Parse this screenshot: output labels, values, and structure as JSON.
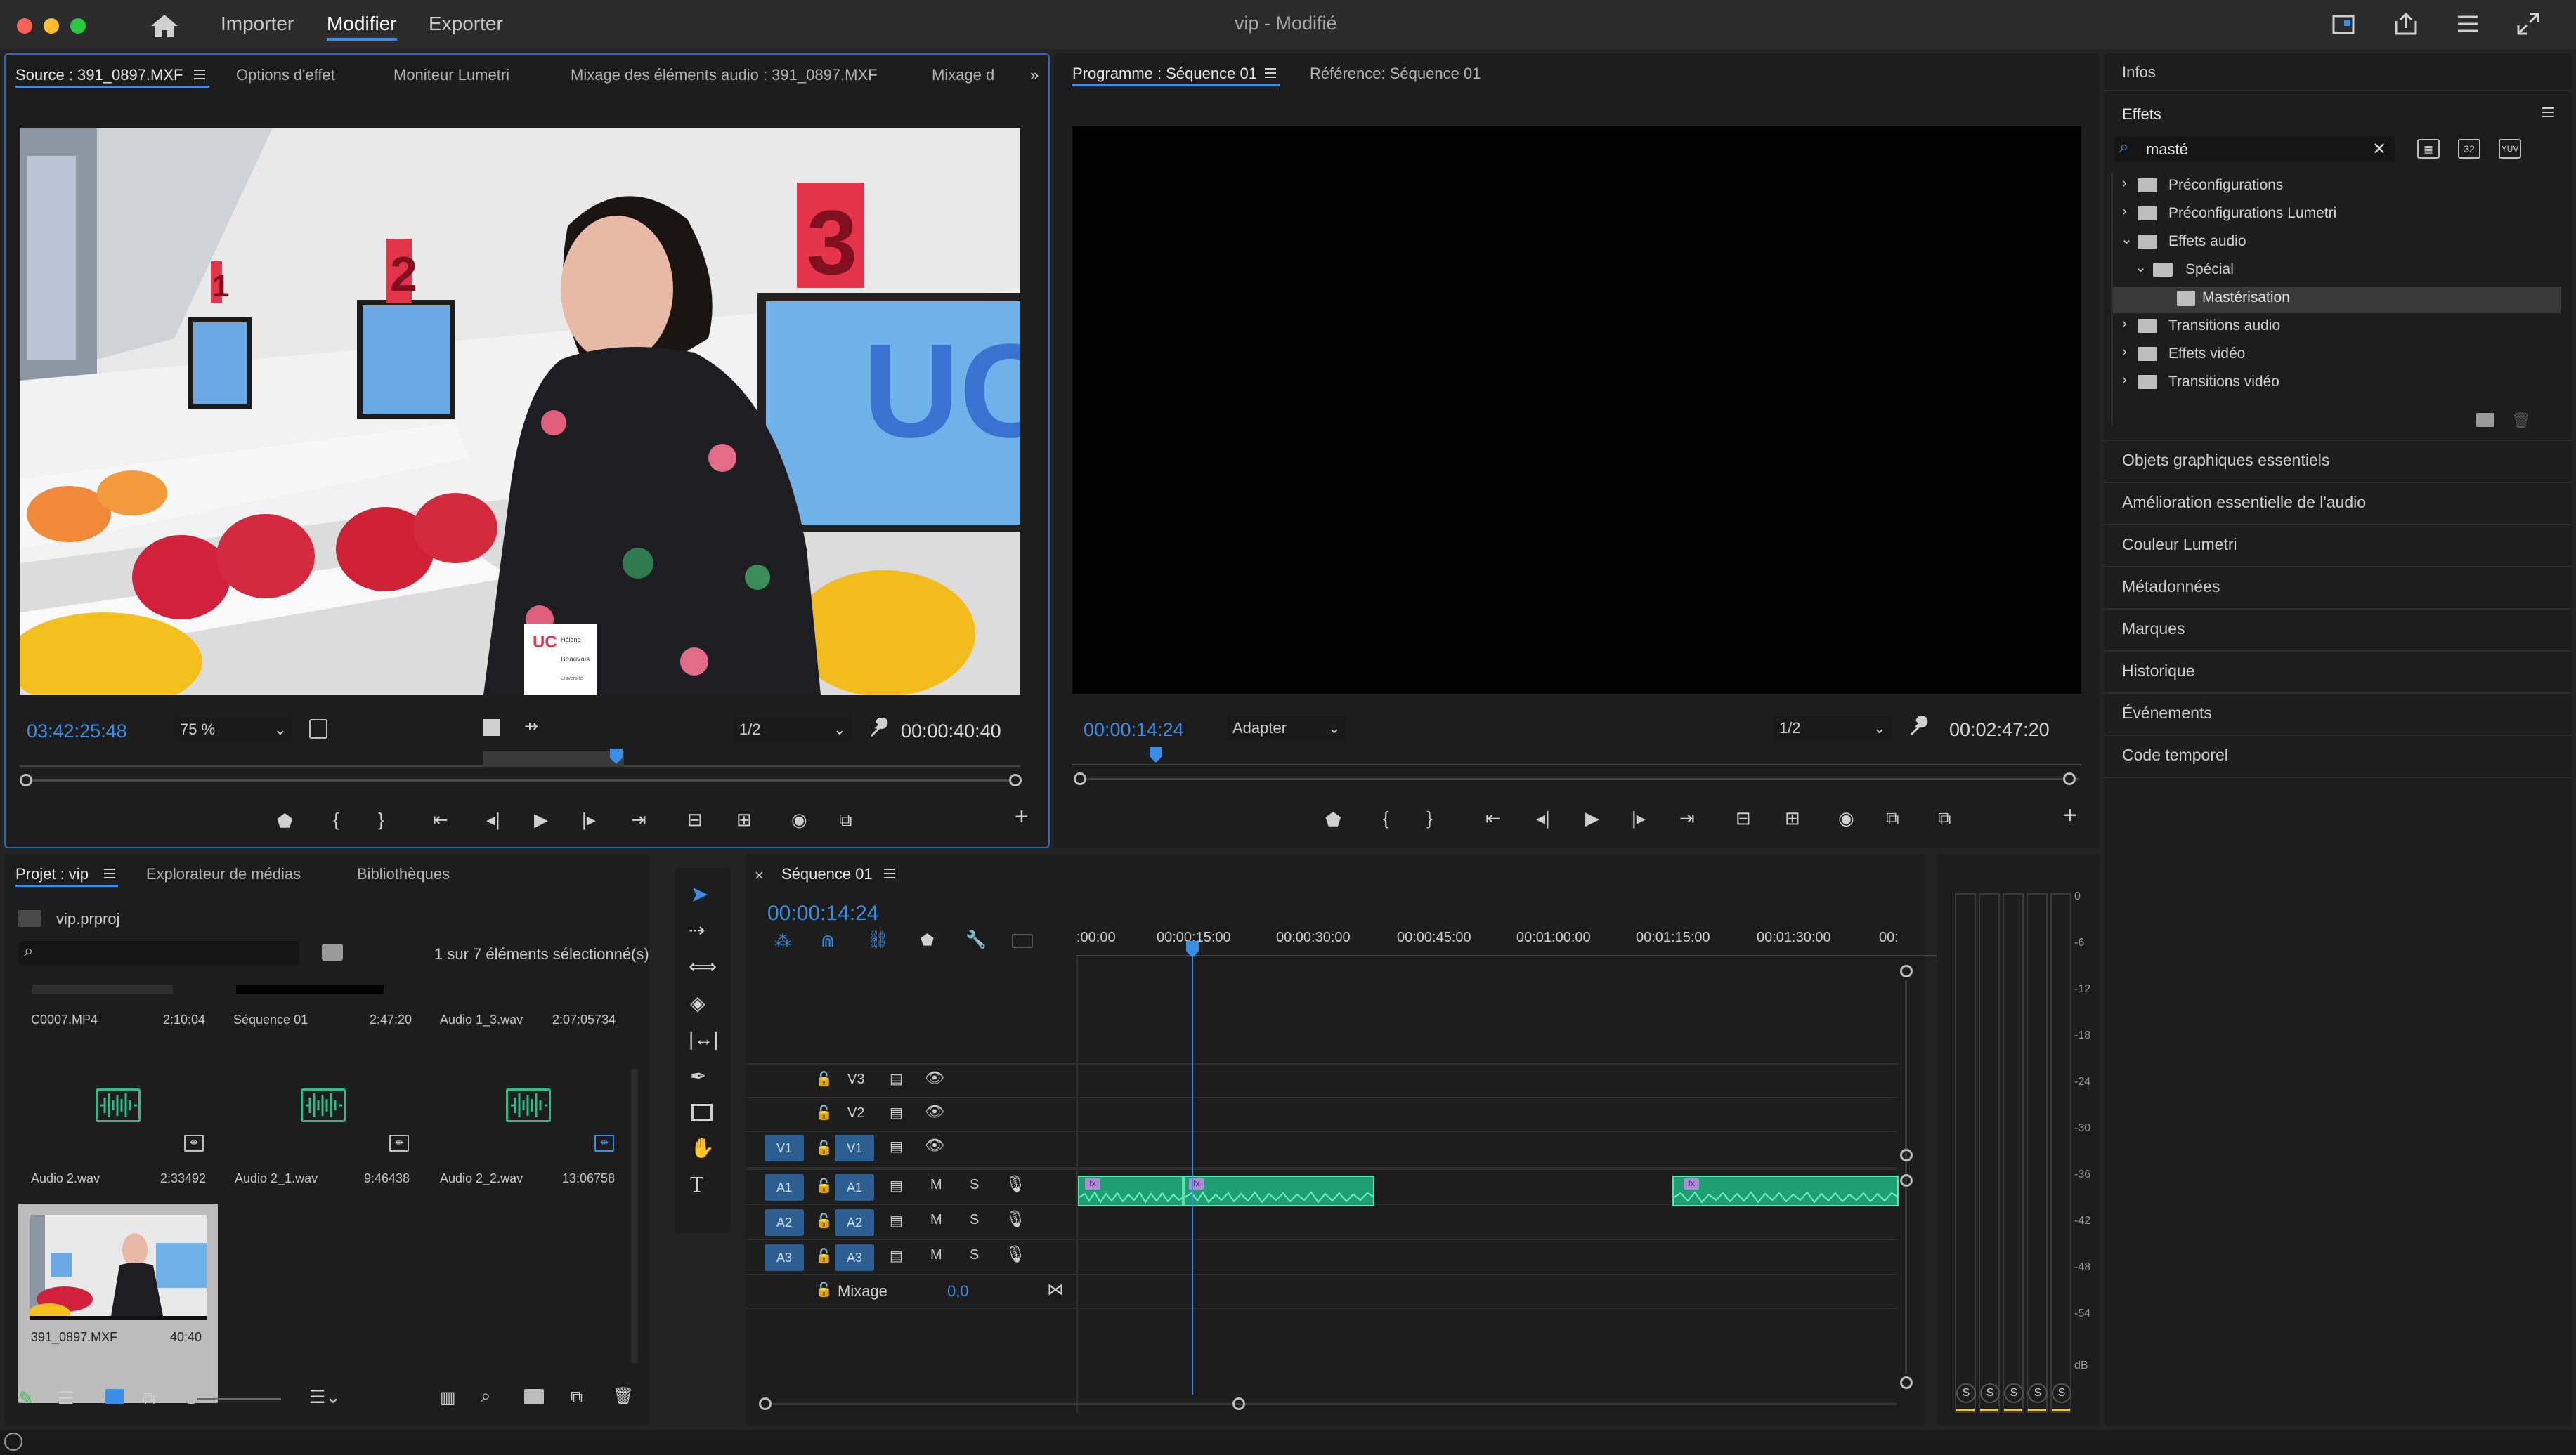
{
  "menubar": {
    "tabs": [
      "Importer",
      "Modifier",
      "Exporter"
    ],
    "title": "vip",
    "subtitle": " - Modifié"
  },
  "source": {
    "tabs": [
      "Source : 391_0897.MXF",
      "Options d'effet",
      "Moniteur Lumetri",
      "Mixage des éléments audio : 391_0897.MXF",
      "Mixage d"
    ],
    "timecode_in": "03:42:25:48",
    "zoom": "75 %",
    "resolution": "1/2",
    "duration": "00:00:40:40",
    "signs": [
      {
        "text": "1",
        "color": "#e3344a"
      },
      {
        "text": "2",
        "color": "#e3344a"
      },
      {
        "text": "3",
        "color": "#e3344a"
      }
    ],
    "badge": {
      "logo": "UC",
      "line1": "Hélène",
      "line2": "Beauvais",
      "line3": "Université"
    },
    "screen_logo": "UC"
  },
  "program": {
    "tabs": [
      "Programme : Séquence 01",
      "Référence: Séquence 01"
    ],
    "timecode": "00:00:14:24",
    "fit": "Adapter",
    "resolution": "1/2",
    "duration": "00:02:47:20"
  },
  "effects": {
    "info_label": "Infos",
    "panel_title": "Effets",
    "search_value": "masté",
    "tree": [
      {
        "label": "Préconfigurations",
        "level": 0
      },
      {
        "label": "Préconfigurations Lumetri",
        "level": 0
      },
      {
        "label": "Effets audio",
        "level": 0
      },
      {
        "label": "Spécial",
        "level": 1
      },
      {
        "label": "Mastérisation",
        "level": 2
      },
      {
        "label": "Transitions audio",
        "level": 0
      },
      {
        "label": "Effets vidéo",
        "level": 0
      },
      {
        "label": "Transitions vidéo",
        "level": 0
      }
    ],
    "sections": [
      "Objets graphiques essentiels",
      "Amélioration essentielle de l'audio",
      "Couleur Lumetri",
      "Métadonnées",
      "Marques",
      "Historique",
      "Événements",
      "Code temporel"
    ]
  },
  "project": {
    "tabs": [
      "Projet : vip",
      "Explorateur de médias",
      "Bibliothèques"
    ],
    "file": "vip.prproj",
    "count_text": "1 sur 7 éléments sélectionné(s)",
    "items": [
      {
        "name": "C0007.MP4",
        "duration": "2:10:04"
      },
      {
        "name": "Séquence 01",
        "duration": "2:47:20"
      },
      {
        "name": "Audio 1_3.wav",
        "duration": "2:07:05734"
      },
      {
        "name": "Audio 2.wav",
        "duration": "2:33492"
      },
      {
        "name": "Audio 2_1.wav",
        "duration": "9:46438"
      },
      {
        "name": "Audio 2_2.wav",
        "duration": "13:06758"
      },
      {
        "name": "391_0897.MXF",
        "duration": "40:40"
      }
    ]
  },
  "timeline": {
    "sequence": "Séquence 01",
    "timecode": "00:00:14:24",
    "ruler": [
      ":00:00",
      "00:00:15:00",
      "00:00:30:00",
      "00:00:45:00",
      "00:01:00:00",
      "00:01:15:00",
      "00:01:30:00",
      "00:"
    ],
    "video_tracks": [
      "V3",
      "V2",
      "V1"
    ],
    "audio_tracks": [
      "A1",
      "A2",
      "A3"
    ],
    "source_video": "V1",
    "source_audio": [
      "A1",
      "A2",
      "A3"
    ],
    "mix_label": "Mixage",
    "mix_value": "0,0",
    "mute": "M",
    "solo": "S",
    "fx": "fx"
  },
  "meter": {
    "scale": [
      "0",
      "-6",
      "-12",
      "-18",
      "-24",
      "-30",
      "-36",
      "-42",
      "-48",
      "-54",
      "dB"
    ],
    "solo": [
      "S",
      "S",
      "S",
      "S",
      "S"
    ]
  }
}
